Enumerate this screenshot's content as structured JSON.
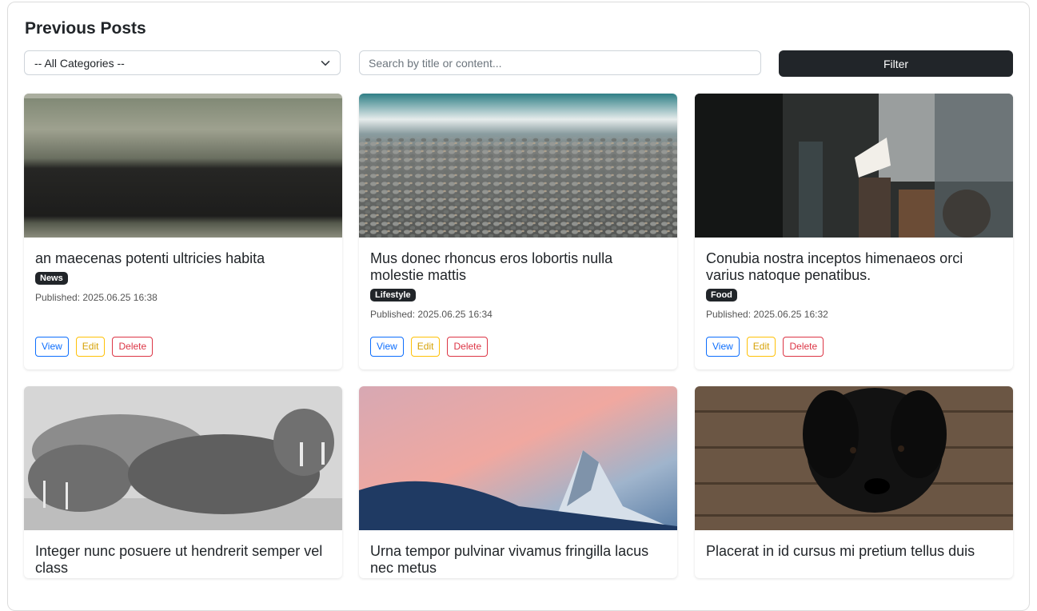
{
  "header": {
    "title": "Previous Posts"
  },
  "filters": {
    "category_selected": "-- All Categories --",
    "search_placeholder": "Search by title or content...",
    "filter_label": "Filter"
  },
  "posts": [
    {
      "title": "an maecenas potenti ultricies habita",
      "category": "News",
      "published": "Published: 2025.06.25 16:38",
      "view": "View",
      "edit": "Edit",
      "delete": "Delete",
      "image": "grass-field-photo"
    },
    {
      "title": "Mus donec rhoncus eros lobortis nulla molestie mattis",
      "category": "Lifestyle",
      "published": "Published: 2025.06.25 16:34",
      "view": "View",
      "edit": "Edit",
      "delete": "Delete",
      "image": "pebble-beach-photo"
    },
    {
      "title": "Conubia nostra inceptos himenaeos orci varius natoque penatibus.",
      "category": "Food",
      "published": "Published: 2025.06.25 16:32",
      "view": "View",
      "edit": "Edit",
      "delete": "Delete",
      "image": "coffee-bar-photo"
    },
    {
      "title": "Integer nunc posuere ut hendrerit semper vel class",
      "image": "walrus-photo"
    },
    {
      "title": "Urna tempor pulvinar vivamus fringilla lacus nec metus",
      "image": "mountain-sunset-photo"
    },
    {
      "title": "Placerat in id cursus mi pretium tellus duis",
      "image": "black-puppy-photo"
    }
  ]
}
